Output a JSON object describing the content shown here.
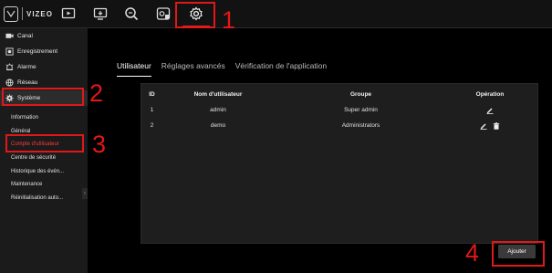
{
  "brand": {
    "name": "VIZEO"
  },
  "topbar": {
    "icons": [
      "playback-icon",
      "preview-icon",
      "search-icon",
      "ai-icon",
      "settings-icon"
    ]
  },
  "annotations": [
    "1",
    "2",
    "3",
    "4"
  ],
  "sidebar": {
    "items": [
      {
        "label": "Canal",
        "icon": "camera-icon"
      },
      {
        "label": "Enregistrement",
        "icon": "record-icon"
      },
      {
        "label": "Alarme",
        "icon": "alarm-icon"
      },
      {
        "label": "Réseau",
        "icon": "network-icon"
      },
      {
        "label": "Système",
        "icon": "gear-icon"
      }
    ],
    "system_sub": [
      "Information",
      "Général",
      "Compte d'utilisateur",
      "Centre de sécurité",
      "Historique des évén...",
      "Maintenance",
      "Réinitialisation auto..."
    ]
  },
  "tabs": [
    "Utilisateur",
    "Réglages avancés",
    "Vérification de l'application"
  ],
  "table": {
    "headers": {
      "id": "ID",
      "name": "Nom d'utilisateur",
      "group": "Groupe",
      "op": "Opération"
    },
    "rows": [
      {
        "id": "1",
        "name": "admin",
        "group": "Super admin"
      },
      {
        "id": "2",
        "name": "demo",
        "group": "Administrators"
      }
    ]
  },
  "buttons": {
    "add": "Ajouter"
  },
  "colors": {
    "accent": "#e01818",
    "active_sub": "#ff3b3b"
  }
}
